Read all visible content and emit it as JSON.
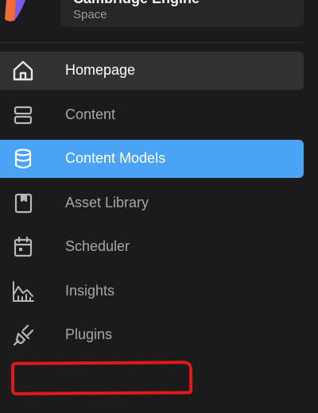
{
  "header": {
    "space_name": "Cambridge Engine",
    "space_subtitle": "Space",
    "logo_colors": [
      "#f26b3a",
      "#7b5cf0"
    ]
  },
  "nav": {
    "items": [
      {
        "label": "Homepage",
        "icon": "home-icon",
        "state": "hover"
      },
      {
        "label": "Content",
        "icon": "content-icon",
        "state": "default"
      },
      {
        "label": "Content Models",
        "icon": "database-icon",
        "state": "active"
      },
      {
        "label": "Asset Library",
        "icon": "asset-library-icon",
        "state": "default"
      },
      {
        "label": "Scheduler",
        "icon": "calendar-icon",
        "state": "default"
      },
      {
        "label": "Insights",
        "icon": "insights-chart-icon",
        "state": "default"
      },
      {
        "label": "Plugins",
        "icon": "plug-icon",
        "state": "default"
      }
    ]
  },
  "colors": {
    "background": "#1b1b1b",
    "active": "#4ba3f5",
    "hover": "#323232",
    "annotation": "#e01a1a"
  }
}
